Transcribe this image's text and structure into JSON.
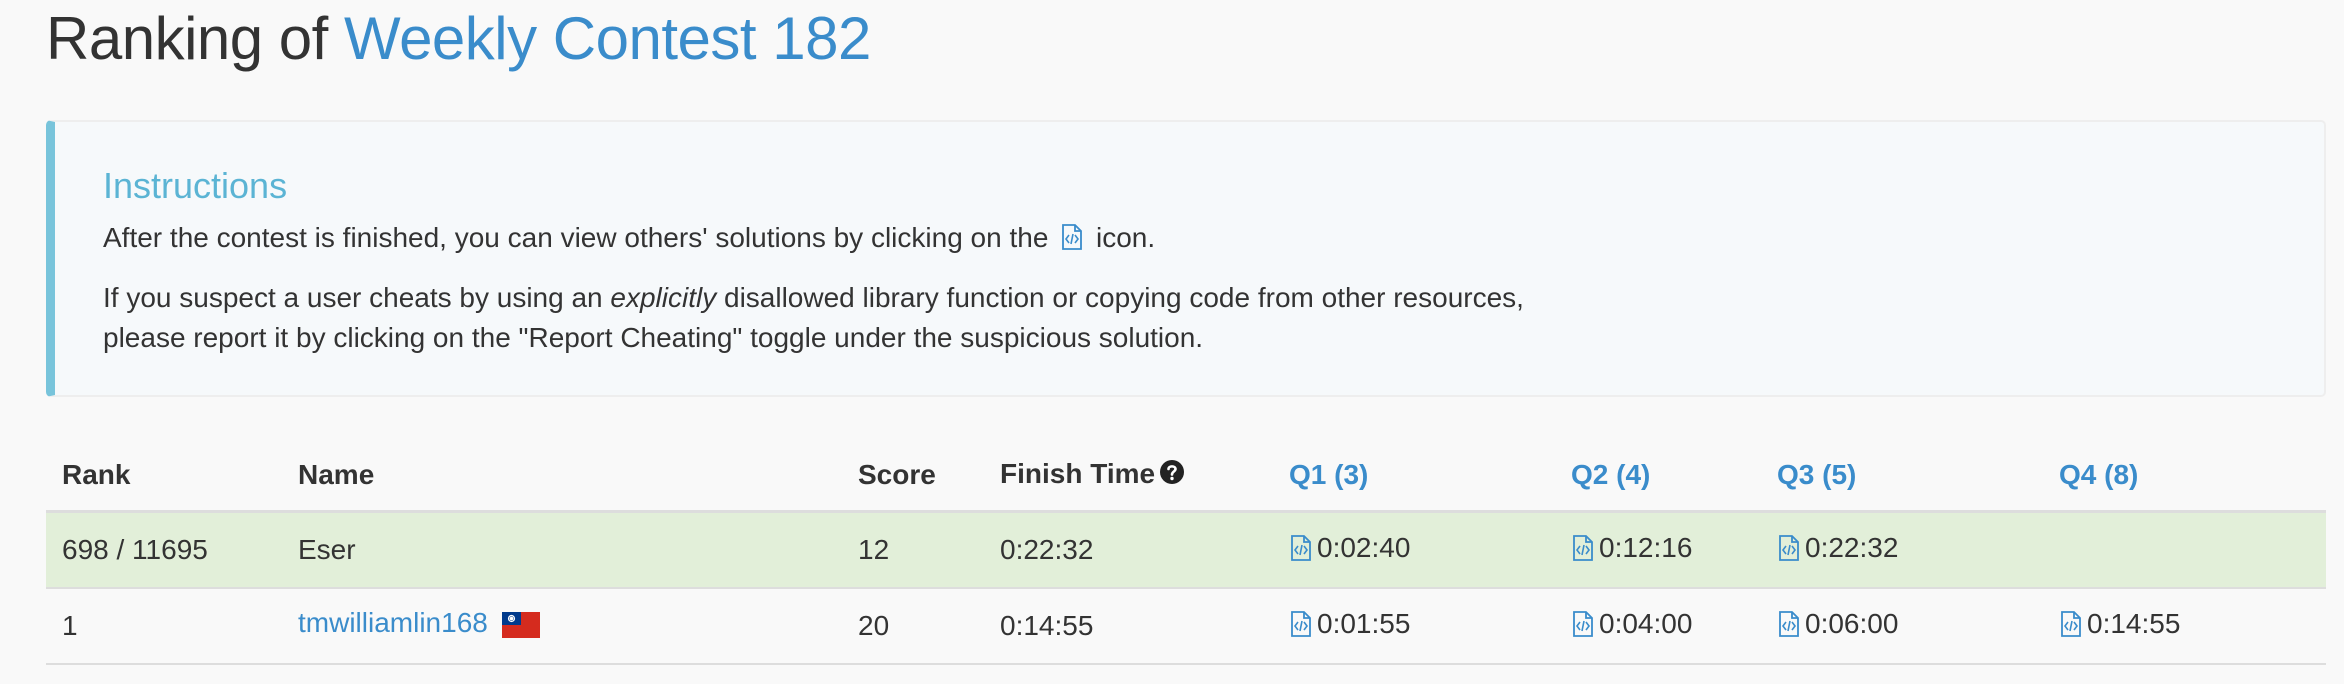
{
  "title": {
    "prefix": "Ranking of ",
    "contest": "Weekly Contest 182"
  },
  "instructions": {
    "heading": "Instructions",
    "p1_before": "After the contest is finished, you can view others' solutions by clicking on the ",
    "p1_after": " icon.",
    "p2_line1_before": "If you suspect a user cheats by using an ",
    "p2_emphasis": "explicitly",
    "p2_line1_after": " disallowed library function or copying code from other resources,",
    "p2_line2": "please report it by clicking on the \"Report Cheating\" toggle under the suspicious solution."
  },
  "table": {
    "headers": {
      "rank": "Rank",
      "name": "Name",
      "score": "Score",
      "finish_time": "Finish Time",
      "q1": "Q1 (3)",
      "q2": "Q2 (4)",
      "q3": "Q3 (5)",
      "q4": "Q4 (8)"
    },
    "rows": [
      {
        "rank": "698 / 11695",
        "name": "Eser",
        "score": "12",
        "finish_time": "0:22:32",
        "q1": "0:02:40",
        "q2": "0:12:16",
        "q3": "0:22:32",
        "q4": ""
      },
      {
        "rank": "1",
        "name": "tmwilliamlin168",
        "flag": "taiwan-flag",
        "score": "20",
        "finish_time": "0:14:55",
        "q1": "0:01:55",
        "q2": "0:04:00",
        "q3": "0:06:00",
        "q4": "0:14:55"
      }
    ]
  },
  "colors": {
    "link": "#3a8ccb",
    "callout_accent": "#78c4db",
    "highlight_row": "#e2efd9"
  },
  "icons": {
    "code": "code-file-icon",
    "help": "question-circle-icon"
  }
}
